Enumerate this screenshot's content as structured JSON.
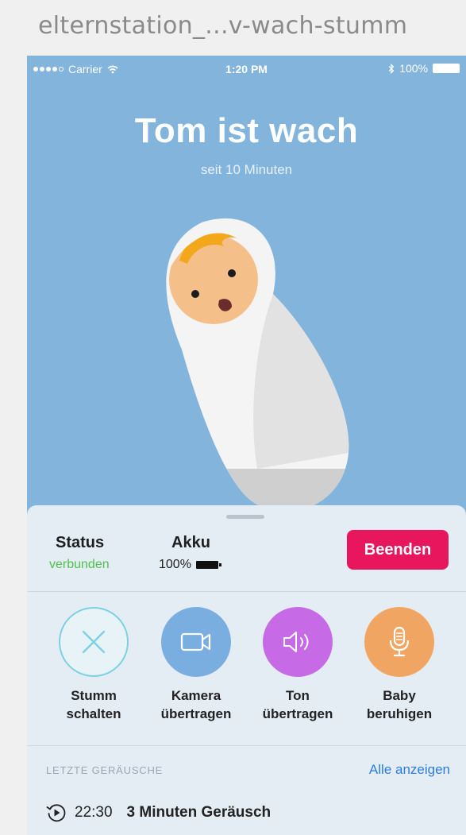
{
  "file": {
    "title": "elternstation_...v-wach-stumm"
  },
  "statusbar": {
    "carrier": "Carrier",
    "time": "1:20 PM",
    "battery": "100%"
  },
  "hero": {
    "title": "Tom ist wach",
    "subtitle": "seit 10 Minuten"
  },
  "panel": {
    "status": {
      "label": "Status",
      "value": "verbunden"
    },
    "battery": {
      "label": "Akku",
      "value": "100%"
    },
    "end_button": "Beenden",
    "actions": [
      {
        "line1": "Stumm",
        "line2": "schalten",
        "icon": "close-icon"
      },
      {
        "line1": "Kamera",
        "line2": "übertragen",
        "icon": "camera-icon"
      },
      {
        "line1": "Ton",
        "line2": "übertragen",
        "icon": "speaker-icon"
      },
      {
        "line1": "Baby",
        "line2": "beruhigen",
        "icon": "microphone-icon"
      }
    ],
    "recent": {
      "title": "LETZTE GERÄUSCHE",
      "link": "Alle anzeigen",
      "items": [
        {
          "time": "22:30",
          "description": "3 Minuten Geräusch",
          "icon": "play-history-icon"
        }
      ]
    }
  },
  "colors": {
    "sky": "#82b4dc",
    "end_button": "#e8175d",
    "connected": "#4cc34c",
    "camera": "#7aaee0",
    "sound": "#c76ae6",
    "calm": "#f0a662",
    "mute_ring": "#7fd0e0",
    "link": "#2a7de0"
  }
}
